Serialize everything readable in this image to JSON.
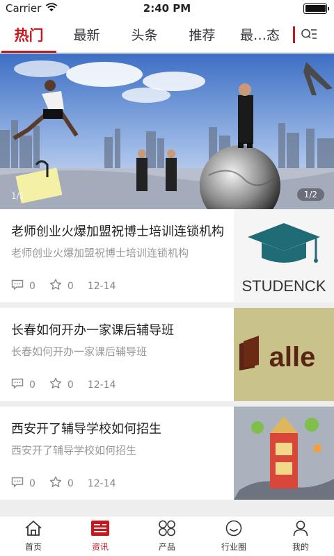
{
  "status_bar": {
    "carrier": "Carrier",
    "time": "2:40 PM"
  },
  "tabs": {
    "items": [
      {
        "label": "热门",
        "active": true
      },
      {
        "label": "最新",
        "active": false
      },
      {
        "label": "头条",
        "active": false
      },
      {
        "label": "推荐",
        "active": false
      },
      {
        "label": "最…态",
        "active": false
      }
    ],
    "more_icon": "search-list-icon"
  },
  "banner": {
    "counter": "1/1",
    "page_indicator": "1/2"
  },
  "news": [
    {
      "title": "老师创业火爆加盟祝博士培训连锁机构",
      "summary": "老师创业火爆加盟祝博士培训连锁机构",
      "comments": "0",
      "favorites": "0",
      "date": "12-14",
      "thumb_text": "STUDENCK"
    },
    {
      "title": "长春如何开办一家课后辅导班",
      "summary": "长春如何开办一家课后辅导班",
      "comments": "0",
      "favorites": "0",
      "date": "12-14",
      "thumb_text": "alle"
    },
    {
      "title": "西安开了辅导学校如何招生",
      "summary": "西安开了辅导学校如何招生",
      "comments": "0",
      "favorites": "0",
      "date": "12-14",
      "thumb_text": ""
    }
  ],
  "bottom_nav": {
    "items": [
      {
        "label": "首页",
        "icon": "home-icon",
        "active": false
      },
      {
        "label": "资讯",
        "icon": "news-icon",
        "active": true
      },
      {
        "label": "产品",
        "icon": "grid-icon",
        "active": false
      },
      {
        "label": "行业圈",
        "icon": "smile-icon",
        "active": false
      },
      {
        "label": "我的",
        "icon": "user-icon",
        "active": false
      }
    ]
  },
  "colors": {
    "accent": "#c8161d",
    "muted_text": "#999999",
    "divider": "#eeeeee"
  }
}
